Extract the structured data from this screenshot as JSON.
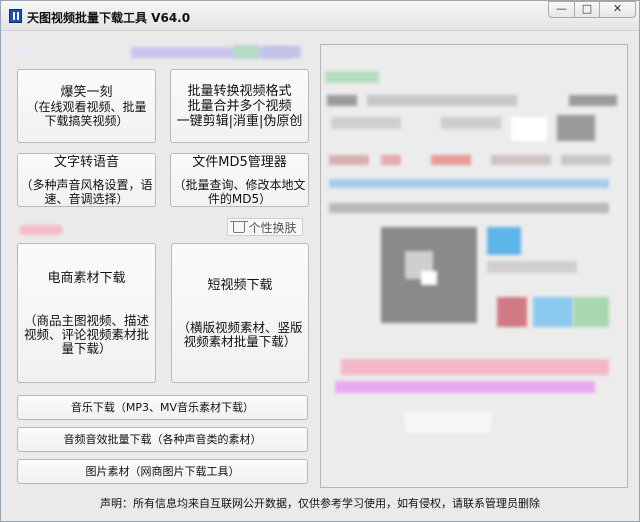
{
  "window": {
    "title": "天图视频批量下载工具 V64.0",
    "controls": {
      "minimize": "—",
      "maximize": "□",
      "close": "✕"
    }
  },
  "buttons": {
    "funny": {
      "title": "爆笑一刻",
      "desc": "（在线观看视频、批量下载搞笑视频）"
    },
    "convert": {
      "line1": "批量转换视频格式",
      "line2": "批量合并多个视频",
      "line3": "一键剪辑|消重|伪原创"
    },
    "tts": {
      "title": "文字转语音",
      "desc": "（多种声音风格设置，语速、音调选择）"
    },
    "md5": {
      "title": "文件MD5管理器",
      "desc": "（批量查询、修改本地文件的MD5）"
    },
    "ecommerce": {
      "title": "电商素材下载",
      "desc": "（商品主图视频、描述视频、评论视频素材批量下载）"
    },
    "short_video": {
      "title": "短视频下载",
      "desc": "（横版视频素材、竖版视频素材批量下载）"
    },
    "music": {
      "label": "音乐下载（MP3、MV音乐素材下载）"
    },
    "sound_effects": {
      "label": "音频音效批量下载（各种声音类的素材）"
    },
    "images": {
      "label": "图片素材（网商图片下载工具）"
    }
  },
  "skin": {
    "label": "个性换肤",
    "icon": "shirt-icon"
  },
  "notice": "声明：所有信息均来自互联网公开数据，仅供参考学习使用，如有侵权，请联系管理员删除"
}
